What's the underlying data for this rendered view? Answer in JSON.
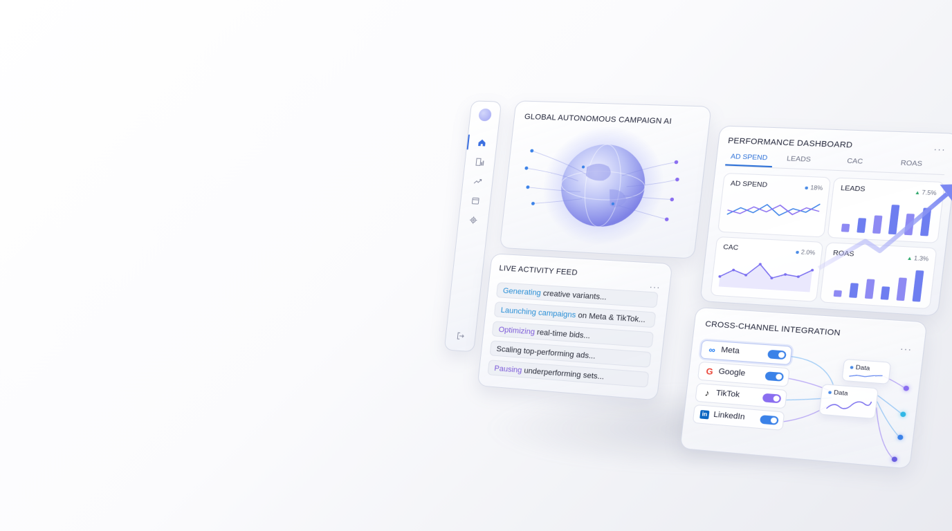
{
  "sidebar": {
    "items": [
      {
        "icon": "home-icon",
        "active": true
      },
      {
        "icon": "chart-bars-icon",
        "active": false
      },
      {
        "icon": "trend-up-icon",
        "active": false
      },
      {
        "icon": "calendar-icon",
        "active": false
      },
      {
        "icon": "gear-icon",
        "active": false
      }
    ],
    "bottom_icon": "logout-icon"
  },
  "campaign": {
    "title": "GLOBAL AUTONOMOUS CAMPAIGN AI"
  },
  "feed": {
    "title": "LIVE ACTIVITY FEED",
    "menu": "···",
    "items": [
      {
        "highlight": "Generating",
        "rest": " creative variants...",
        "color": "#2a8fd6"
      },
      {
        "highlight": "Launching campaigns",
        "rest": " on Meta & TikTok...",
        "color": "#2a8fd6"
      },
      {
        "highlight": "Optimizing",
        "rest": " real-time bids...",
        "color": "#7d5bd9"
      },
      {
        "highlight": "",
        "rest": "Scaling top-performing ads...",
        "color": "#2a2d3a"
      },
      {
        "highlight": "Pausing",
        "rest": " underperforming sets...",
        "color": "#7d5bd9"
      }
    ]
  },
  "performance": {
    "title": "PERFORMANCE DASHBOARD",
    "menu": "···",
    "tabs": [
      "AD SPEND",
      "LEADS",
      "CAC",
      "ROAS"
    ],
    "active_tab": "AD SPEND",
    "cards": {
      "ad_spend": {
        "title": "AD SPEND",
        "delta": "18%",
        "series_a": [
          0.3,
          0.55,
          0.4,
          0.7,
          0.35,
          0.6,
          0.5,
          0.8
        ],
        "series_b": [
          0.45,
          0.35,
          0.6,
          0.45,
          0.7,
          0.4,
          0.65,
          0.55
        ]
      },
      "leads": {
        "title": "LEADS",
        "delta": "7.5%",
        "bars": [
          0.25,
          0.45,
          0.55,
          0.9,
          0.65,
          0.85
        ]
      },
      "cac": {
        "title": "CAC",
        "delta": "2.0%",
        "series": [
          0.35,
          0.6,
          0.45,
          0.85,
          0.4,
          0.55,
          0.5,
          0.75
        ]
      },
      "roas": {
        "title": "ROAS",
        "delta": "1.3%",
        "bars": [
          0.2,
          0.45,
          0.6,
          0.4,
          0.7,
          0.95
        ]
      }
    },
    "colors": {
      "accent": "#2e72d8",
      "purple": "#7a6ef0",
      "positive": "#2ea86b"
    }
  },
  "integration": {
    "title": "CROSS-CHANNEL INTEGRATION",
    "menu": "···",
    "channels": [
      {
        "name": "Meta",
        "icon": "meta-icon",
        "enabled": true,
        "toggle_color": "#3b82e8"
      },
      {
        "name": "Google",
        "icon": "google-icon",
        "enabled": true,
        "toggle_color": "#3b82e8"
      },
      {
        "name": "TikTok",
        "icon": "tiktok-icon",
        "enabled": true,
        "toggle_color": "#8a6ef0"
      },
      {
        "name": "LinkedIn",
        "icon": "linkedin-icon",
        "enabled": true,
        "toggle_color": "#3b82e8"
      }
    ],
    "data_cards": [
      "Data",
      "Data"
    ]
  }
}
